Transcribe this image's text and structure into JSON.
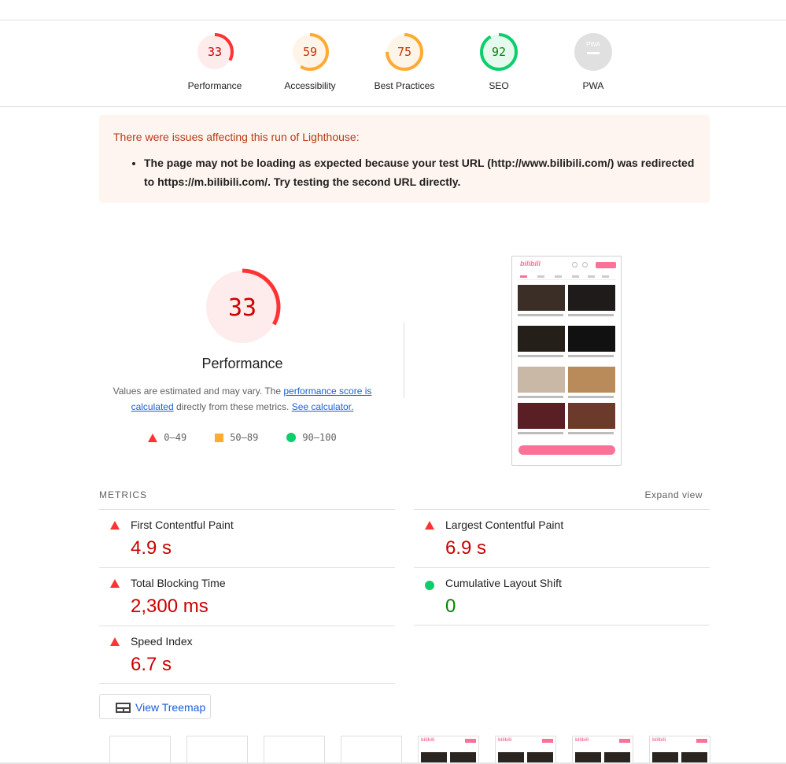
{
  "categories": [
    {
      "score": "33",
      "label": "Performance",
      "fraction": 0.33,
      "color": "#ff3333",
      "bg": "#fdeceb",
      "text": "#c00"
    },
    {
      "score": "59",
      "label": "Accessibility",
      "fraction": 0.59,
      "color": "#ffaa33",
      "bg": "#fff4e8",
      "text": "#c33300"
    },
    {
      "score": "75",
      "label": "Best Practices",
      "fraction": 0.75,
      "color": "#ffaa33",
      "bg": "#fff4e8",
      "text": "#c33300"
    },
    {
      "score": "92",
      "label": "SEO",
      "fraction": 0.92,
      "color": "#0cce6b",
      "bg": "#e6f9ee",
      "text": "#008800"
    },
    {
      "score": "PWA",
      "label": "PWA",
      "fraction": 0,
      "color": "#cccccc",
      "bg": "#e0e0e0",
      "text": "#ffffff"
    }
  ],
  "warning": {
    "title": "There were issues affecting this run of Lighthouse:",
    "items": [
      "The page may not be loading as expected because your test URL (http://www.bilibili.com/) was redirected to https://m.bilibili.com/. Try testing the second URL directly."
    ]
  },
  "performance": {
    "score": "33",
    "fraction": 0.33,
    "title": "Performance",
    "note_prefix": "Values are estimated and may vary. The ",
    "note_link1": "performance score is calculated",
    "note_mid": " directly from these metrics. ",
    "note_link2": "See calculator.",
    "legend": [
      {
        "range": "0–49",
        "shape": "triangle"
      },
      {
        "range": "50–89",
        "shape": "square"
      },
      {
        "range": "90–100",
        "shape": "circle"
      }
    ]
  },
  "metrics": {
    "header": "METRICS",
    "expand": "Expand view",
    "items": [
      {
        "title": "First Contentful Paint",
        "value": "4.9 s",
        "status": "fail"
      },
      {
        "title": "Largest Contentful Paint",
        "value": "6.9 s",
        "status": "fail"
      },
      {
        "title": "Total Blocking Time",
        "value": "2,300 ms",
        "status": "fail"
      },
      {
        "title": "Cumulative Layout Shift",
        "value": "0",
        "status": "pass"
      },
      {
        "title": "Speed Index",
        "value": "6.7 s",
        "status": "fail"
      }
    ]
  },
  "treemap": {
    "label": "View Treemap",
    "icon": "treemap-icon"
  },
  "screenshot": {
    "logo": "bilibili"
  }
}
